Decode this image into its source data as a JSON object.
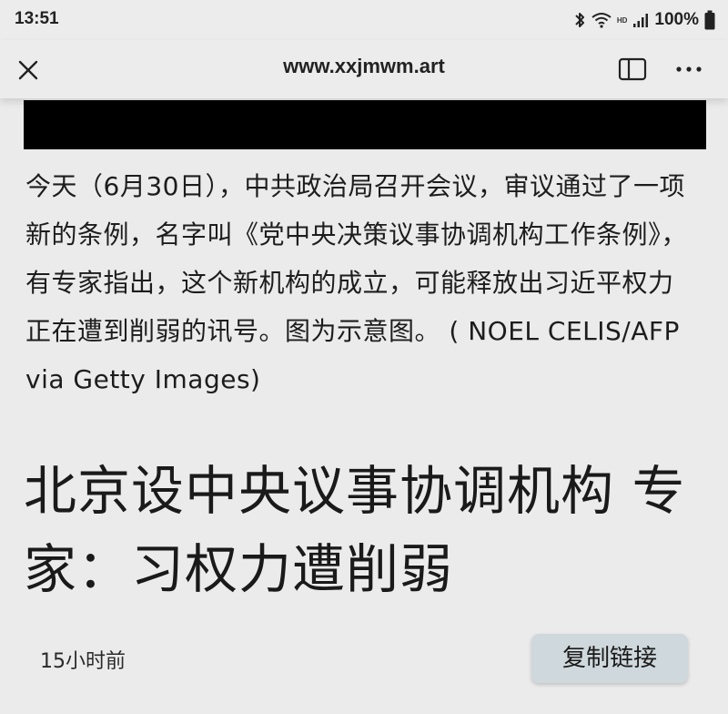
{
  "status_bar": {
    "time": "13:51",
    "battery": "100%",
    "hd": "HD",
    "icons": [
      "bluetooth-icon",
      "wifi-icon",
      "signal-icon",
      "battery-icon"
    ]
  },
  "browser": {
    "url": "www.xxjmwm.art",
    "icons": [
      "close-icon",
      "reader-mode-icon",
      "more-icon"
    ]
  },
  "article": {
    "caption": "今天（6月30日），中共政治局召开会议，审议通过了一项新的条例，名字叫《党中央决策议事协调机构工作条例》，有专家指出，这个新机构的成立，可能释放出习近平权力正在遭到削弱的讯号。图为示意图。 ( NOEL CELIS/AFP via Getty Images)",
    "headline": "北京设中央议事协调机构 专家：习权力遭削弱",
    "timestamp": "15小时前",
    "copy_link_label": "复制链接"
  },
  "colors": {
    "background": "#ebebeb",
    "copy_button": "#cfd8dc",
    "image_placeholder": "#000000"
  }
}
